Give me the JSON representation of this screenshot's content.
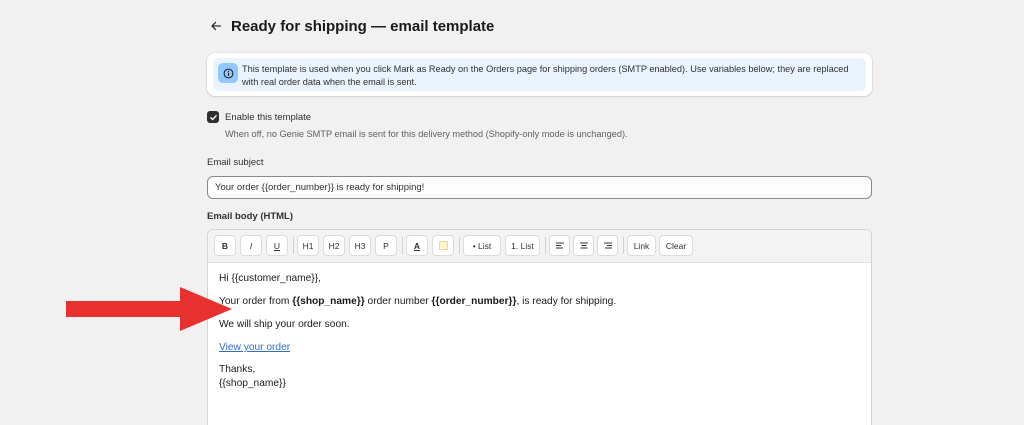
{
  "header": {
    "back_icon": "arrow-left-icon",
    "title": "Ready for shipping — email template"
  },
  "banner": {
    "icon": "info-icon",
    "accent_color": "#91c8ff",
    "text": "This template is used when you click Mark as Ready on the Orders page for shipping orders (SMTP enabled). Use variables below; they are replaced with real order data when the email is sent."
  },
  "enable": {
    "checked": true,
    "label": "Enable this template",
    "help": "When off, no Genie SMTP email is sent for this delivery method (Shopify-only mode is unchanged)."
  },
  "subject": {
    "label": "Email subject",
    "value": "Your order {{order_number}} is ready for shipping!"
  },
  "body": {
    "label": "Email body (HTML)",
    "toolbar": {
      "bold": "B",
      "italic": "I",
      "underline": "U",
      "h1": "H1",
      "h2": "H2",
      "h3": "H3",
      "paragraph": "P",
      "text_color": "A",
      "bullet_list": "• List",
      "numbered_list": "1. List",
      "align_left_icon": "align-left-icon",
      "align_center_icon": "align-center-icon",
      "align_right_icon": "align-right-icon",
      "link": "Link",
      "clear": "Clear"
    },
    "content": {
      "greeting": "Hi {{customer_name}},",
      "line2_a": "Your order from ",
      "line2_b": "{{shop_name}}",
      "line2_c": " order number ",
      "line2_d": "{{order_number}}",
      "line2_e": ", is ready for shipping.",
      "line3": "We will ship your order soon.",
      "link_text": "View your order",
      "thanks": "Thanks,",
      "signature": "{{shop_name}}"
    }
  },
  "annotation": {
    "arrow_color": "#e8312f"
  }
}
